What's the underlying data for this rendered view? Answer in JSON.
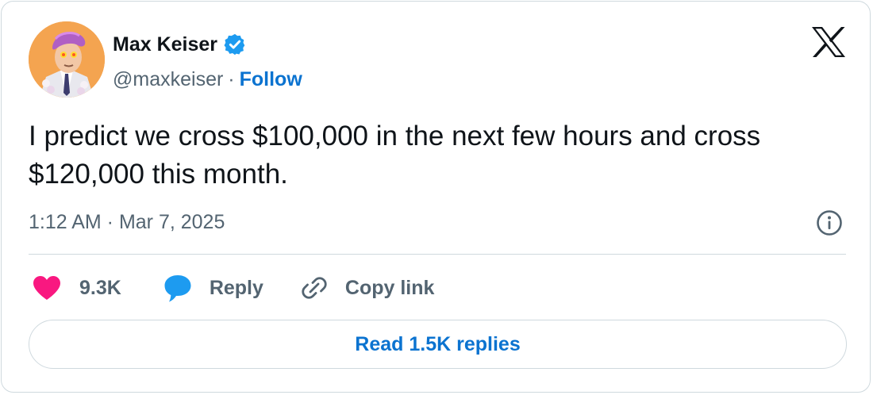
{
  "author": {
    "name": "Max Keiser",
    "handle": "@maxkeiser",
    "separator": "·",
    "follow_label": "Follow",
    "verified": true
  },
  "tweet": {
    "text": "I predict we cross $100,000 in the next few hours and cross $120,000 this month.",
    "timestamp": "1:12 AM · Mar 7, 2025"
  },
  "actions": {
    "like_count": "9.3K",
    "reply_label": "Reply",
    "copy_link_label": "Copy link"
  },
  "footer": {
    "read_replies_label": "Read 1.5K replies"
  },
  "icons": {
    "logo": "x-logo-icon",
    "verified": "verified-badge-icon",
    "info": "info-icon",
    "like": "heart-icon",
    "reply": "speech-bubble-icon",
    "copy": "link-icon"
  },
  "colors": {
    "text_primary": "#0f1419",
    "text_secondary": "#536471",
    "link_blue": "#0b73d0",
    "heart": "#f91880",
    "reply_bubble": "#1d9bf0",
    "verified": "#1d9bf0",
    "border": "#cfd9de",
    "avatar_bg": "#f4a450"
  }
}
